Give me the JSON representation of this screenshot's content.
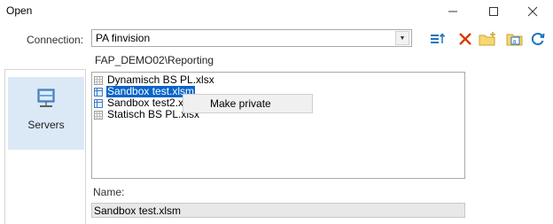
{
  "window": {
    "title": "Open"
  },
  "connection": {
    "label": "Connection:",
    "value": "PA finvision",
    "path": "FAP_DEMO02\\Reporting"
  },
  "toolbar": {
    "icons": [
      "sort-icon",
      "delete-icon",
      "new-folder-icon",
      "rename-icon",
      "refresh-icon"
    ]
  },
  "sidebar": {
    "items": [
      {
        "label": "Servers",
        "icon": "servers-icon",
        "selected": true
      }
    ]
  },
  "files": [
    {
      "name": "Dynamisch BS PL.xlsx",
      "selected": false
    },
    {
      "name": "Sandbox test.xlsm",
      "selected": true
    },
    {
      "name": "Sandbox test2.xlsx",
      "selected": false
    },
    {
      "name": "Statisch BS PL.xlsx",
      "selected": false
    }
  ],
  "context_menu": {
    "items": [
      "Make private"
    ]
  },
  "name_field": {
    "label": "Name:",
    "value": "Sandbox test.xlsm"
  },
  "colors": {
    "selection": "#0a64c8",
    "sidebar_selected": "#dbe9f7",
    "delete": "#d83b01",
    "refresh": "#1e73be"
  }
}
